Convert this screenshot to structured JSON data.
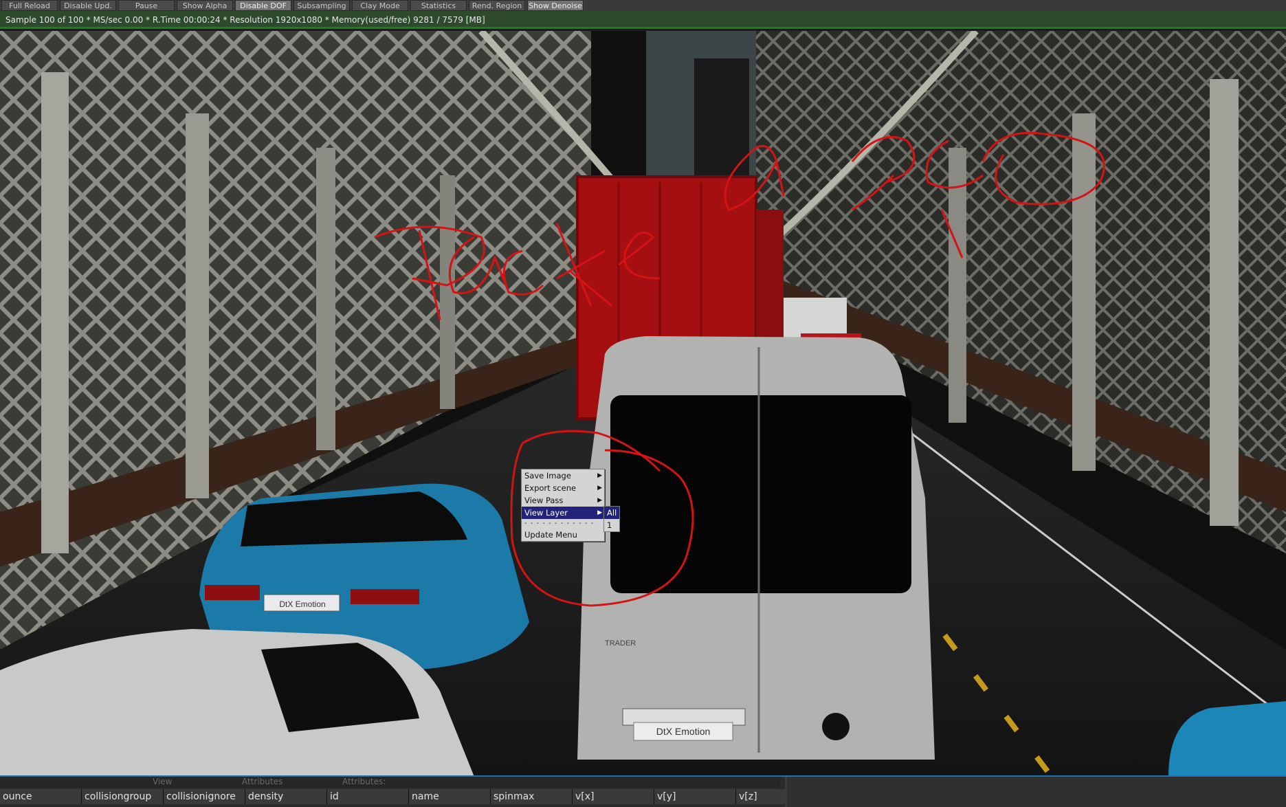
{
  "toolbar": {
    "buttons": [
      {
        "label": "Full Reload",
        "active": false
      },
      {
        "label": "Disable Upd.",
        "active": false
      },
      {
        "label": "Pause",
        "active": false
      },
      {
        "label": "Show Alpha",
        "active": false
      },
      {
        "label": "Disable DOF",
        "active": true
      },
      {
        "label": "Subsampling",
        "active": false
      },
      {
        "label": "Clay Mode",
        "active": false
      },
      {
        "label": "Statistics",
        "active": false
      },
      {
        "label": "Rend. Region",
        "active": false
      },
      {
        "label": "Show Denoise",
        "active": true
      }
    ]
  },
  "status": {
    "text": "Sample 100 of 100 * MS/sec 0.00 * R.Time 00:00:24 * Resolution 1920x1080 * Memory(used/free) 9281 / 7579 [MB]"
  },
  "render": {
    "annotation_text": "Packed geo",
    "plate_label_car": "DtX Emotion",
    "plate_label_van": "DtX Emotion",
    "van_badge": "TRADER",
    "annotation_color": "#d41414"
  },
  "context_menu": {
    "items": [
      {
        "label": "Save Image",
        "submenu": true,
        "selected": false
      },
      {
        "label": "Export scene",
        "submenu": true,
        "selected": false
      },
      {
        "label": "View Pass",
        "submenu": true,
        "selected": false
      },
      {
        "label": "View Layer",
        "submenu": true,
        "selected": true
      }
    ],
    "separator": "- - - - - - - - - - - -",
    "footer_item": "Update Menu",
    "submenu_items": [
      {
        "label": "All",
        "selected": true
      },
      {
        "label": "1",
        "selected": false
      }
    ]
  },
  "bottom_panel": {
    "tabs": [
      "View",
      "Attributes",
      "Attributes:"
    ],
    "columns": [
      "ounce",
      "collisiongroup",
      "collisionignore",
      "density",
      "id",
      "name",
      "spinmax",
      "v[x]",
      "v[y]",
      "v[z]"
    ]
  }
}
